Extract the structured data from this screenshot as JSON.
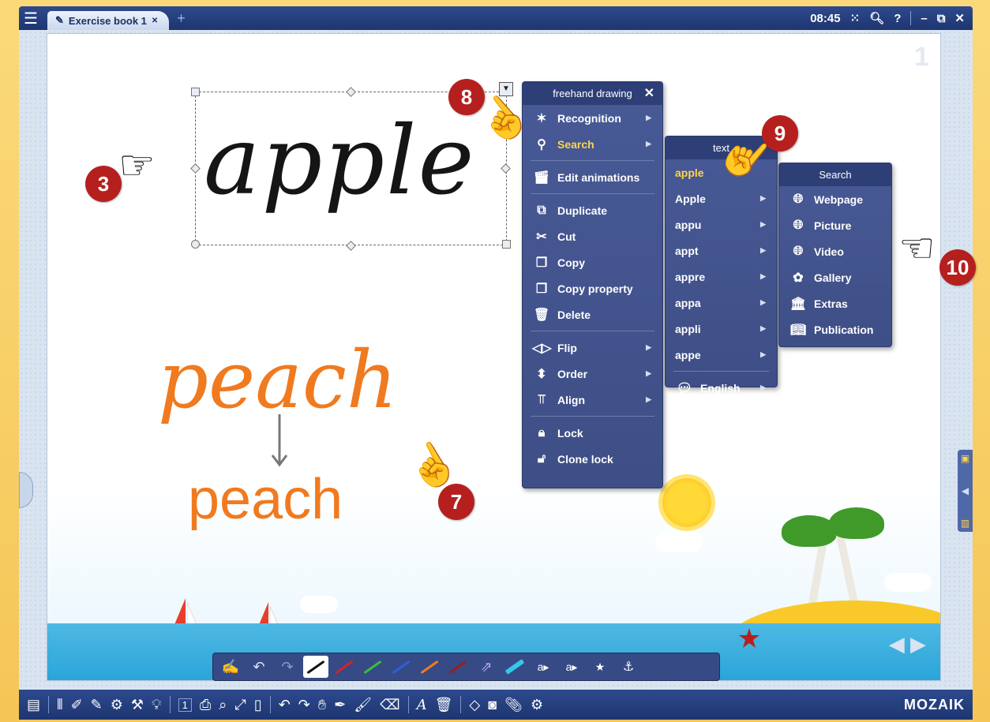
{
  "title_bar": {
    "tab_label": "Exercise book 1",
    "tab_close_glyph": "✕",
    "add_tab_glyph": "+",
    "time": "08:45"
  },
  "page": {
    "number": "1",
    "handwriting_apple": "apple",
    "handwriting_peach": "peach",
    "recognized_text": "peach"
  },
  "menu_main": {
    "title": "freehand drawing",
    "items": [
      {
        "label": "Recognition",
        "icon": "recognition-icon",
        "submenu": true
      },
      {
        "label": "Search",
        "icon": "search-icon",
        "submenu": true,
        "highlighted": true
      },
      {
        "label": "Edit animations",
        "icon": "clapperboard-icon"
      },
      {
        "label": "Duplicate",
        "icon": "duplicate-icon"
      },
      {
        "label": "Cut",
        "icon": "scissors-icon"
      },
      {
        "label": "Copy",
        "icon": "copy-icon"
      },
      {
        "label": "Copy property",
        "icon": "copy-property-icon"
      },
      {
        "label": "Delete",
        "icon": "trash-icon"
      },
      {
        "label": "Flip",
        "icon": "flip-icon",
        "submenu": true
      },
      {
        "label": "Order",
        "icon": "order-icon",
        "submenu": true
      },
      {
        "label": "Align",
        "icon": "align-icon",
        "submenu": true
      },
      {
        "label": "Lock",
        "icon": "lock-icon"
      },
      {
        "label": "Clone lock",
        "icon": "clone-lock-icon"
      }
    ]
  },
  "menu_text": {
    "title": "text",
    "items": [
      "apple",
      "Apple",
      "appu",
      "appt",
      "appre",
      "appa",
      "appli",
      "appe"
    ],
    "language": "English"
  },
  "menu_search": {
    "title": "Search",
    "items": [
      "Webpage",
      "Picture",
      "Video",
      "Gallery",
      "Extras",
      "Publication"
    ]
  },
  "callouts": [
    "3",
    "7",
    "8",
    "9",
    "10"
  ],
  "bottom_brand": "MOZAIK",
  "page_counter": "1",
  "colors": {
    "menu_bg": "#485a96",
    "menu_header": "#2e3f78",
    "highlight": "#ffd34d",
    "callout": "#b5201f",
    "handwriting_orange": "#f07a1f"
  }
}
